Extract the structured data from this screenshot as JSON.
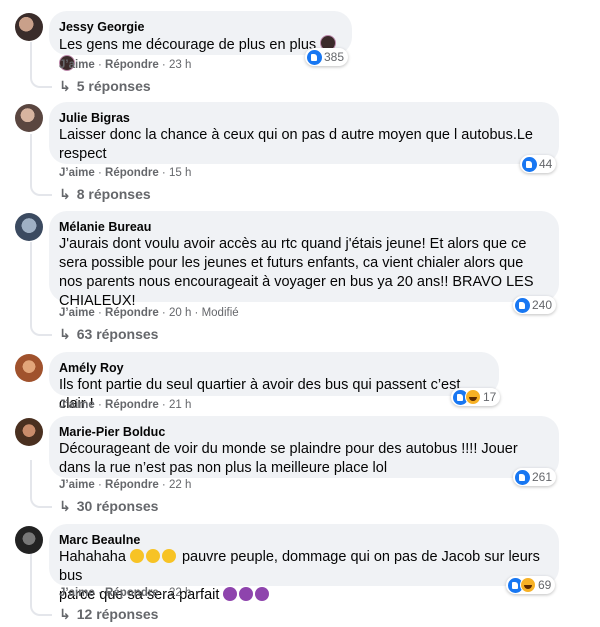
{
  "comments": [
    {
      "author": "Jessy Georgie",
      "text": "Les gens me décourage de plus en plus",
      "emoji_after": [
        "woman-emoji",
        "woman-emoji"
      ],
      "like_label": "J’aime",
      "reply_label": "Répondre",
      "time": "23 h",
      "reactions": "385",
      "replies": "5 réponses"
    },
    {
      "author": "Julie Bigras",
      "text": "Laisser donc la chance à ceux qui on pas d autre moyen que l autobus.Le respect",
      "like_label": "J’aime",
      "reply_label": "Répondre",
      "time": "15 h",
      "reactions": "44",
      "replies": "8 réponses"
    },
    {
      "author": "Mélanie Bureau",
      "text": "J'aurais dont voulu avoir accès au rtc quand j'étais jeune! Et alors que ce sera possible pour les jeunes et futurs enfants, ca vient chialer alors que nos parents nous encourageait à voyager en bus ya 20 ans!! BRAVO LES CHIALEUX!",
      "like_label": "J’aime",
      "reply_label": "Répondre",
      "time": "20 h",
      "edited": "Modifié",
      "reactions": "240",
      "replies": "63 réponses"
    },
    {
      "author": "Amély Roy",
      "text": "Ils font partie du seul quartier à avoir des bus qui passent c’est clair !",
      "like_label": "J’aime",
      "reply_label": "Répondre",
      "time": "21 h",
      "reactions": "17"
    },
    {
      "author": "Marie-Pier Bolduc",
      "text": "Décourageant de voir du monde se plaindre pour des autobus !!!! Jouer dans la rue n’est pas non plus la meilleure place lol",
      "like_label": "J’aime",
      "reply_label": "Répondre",
      "time": "22 h",
      "reactions": "261",
      "replies": "30 réponses"
    },
    {
      "author": "Marc Beaulne",
      "text_line1_start": "Hahahaha",
      "text_line1_end": "pauvre peuple, dommage qui on pas de Jacob sur leurs bus",
      "text_line2": "parce que sa sera parfait",
      "like_label": "J’aime",
      "reply_label": "Répondre",
      "time": "22 h",
      "reactions": "69",
      "replies": "12 réponses"
    }
  ],
  "colors": {
    "bubble": "#f0f2f5",
    "meta": "#65676b",
    "like": "#1877f2",
    "haha": "#f7b125"
  }
}
